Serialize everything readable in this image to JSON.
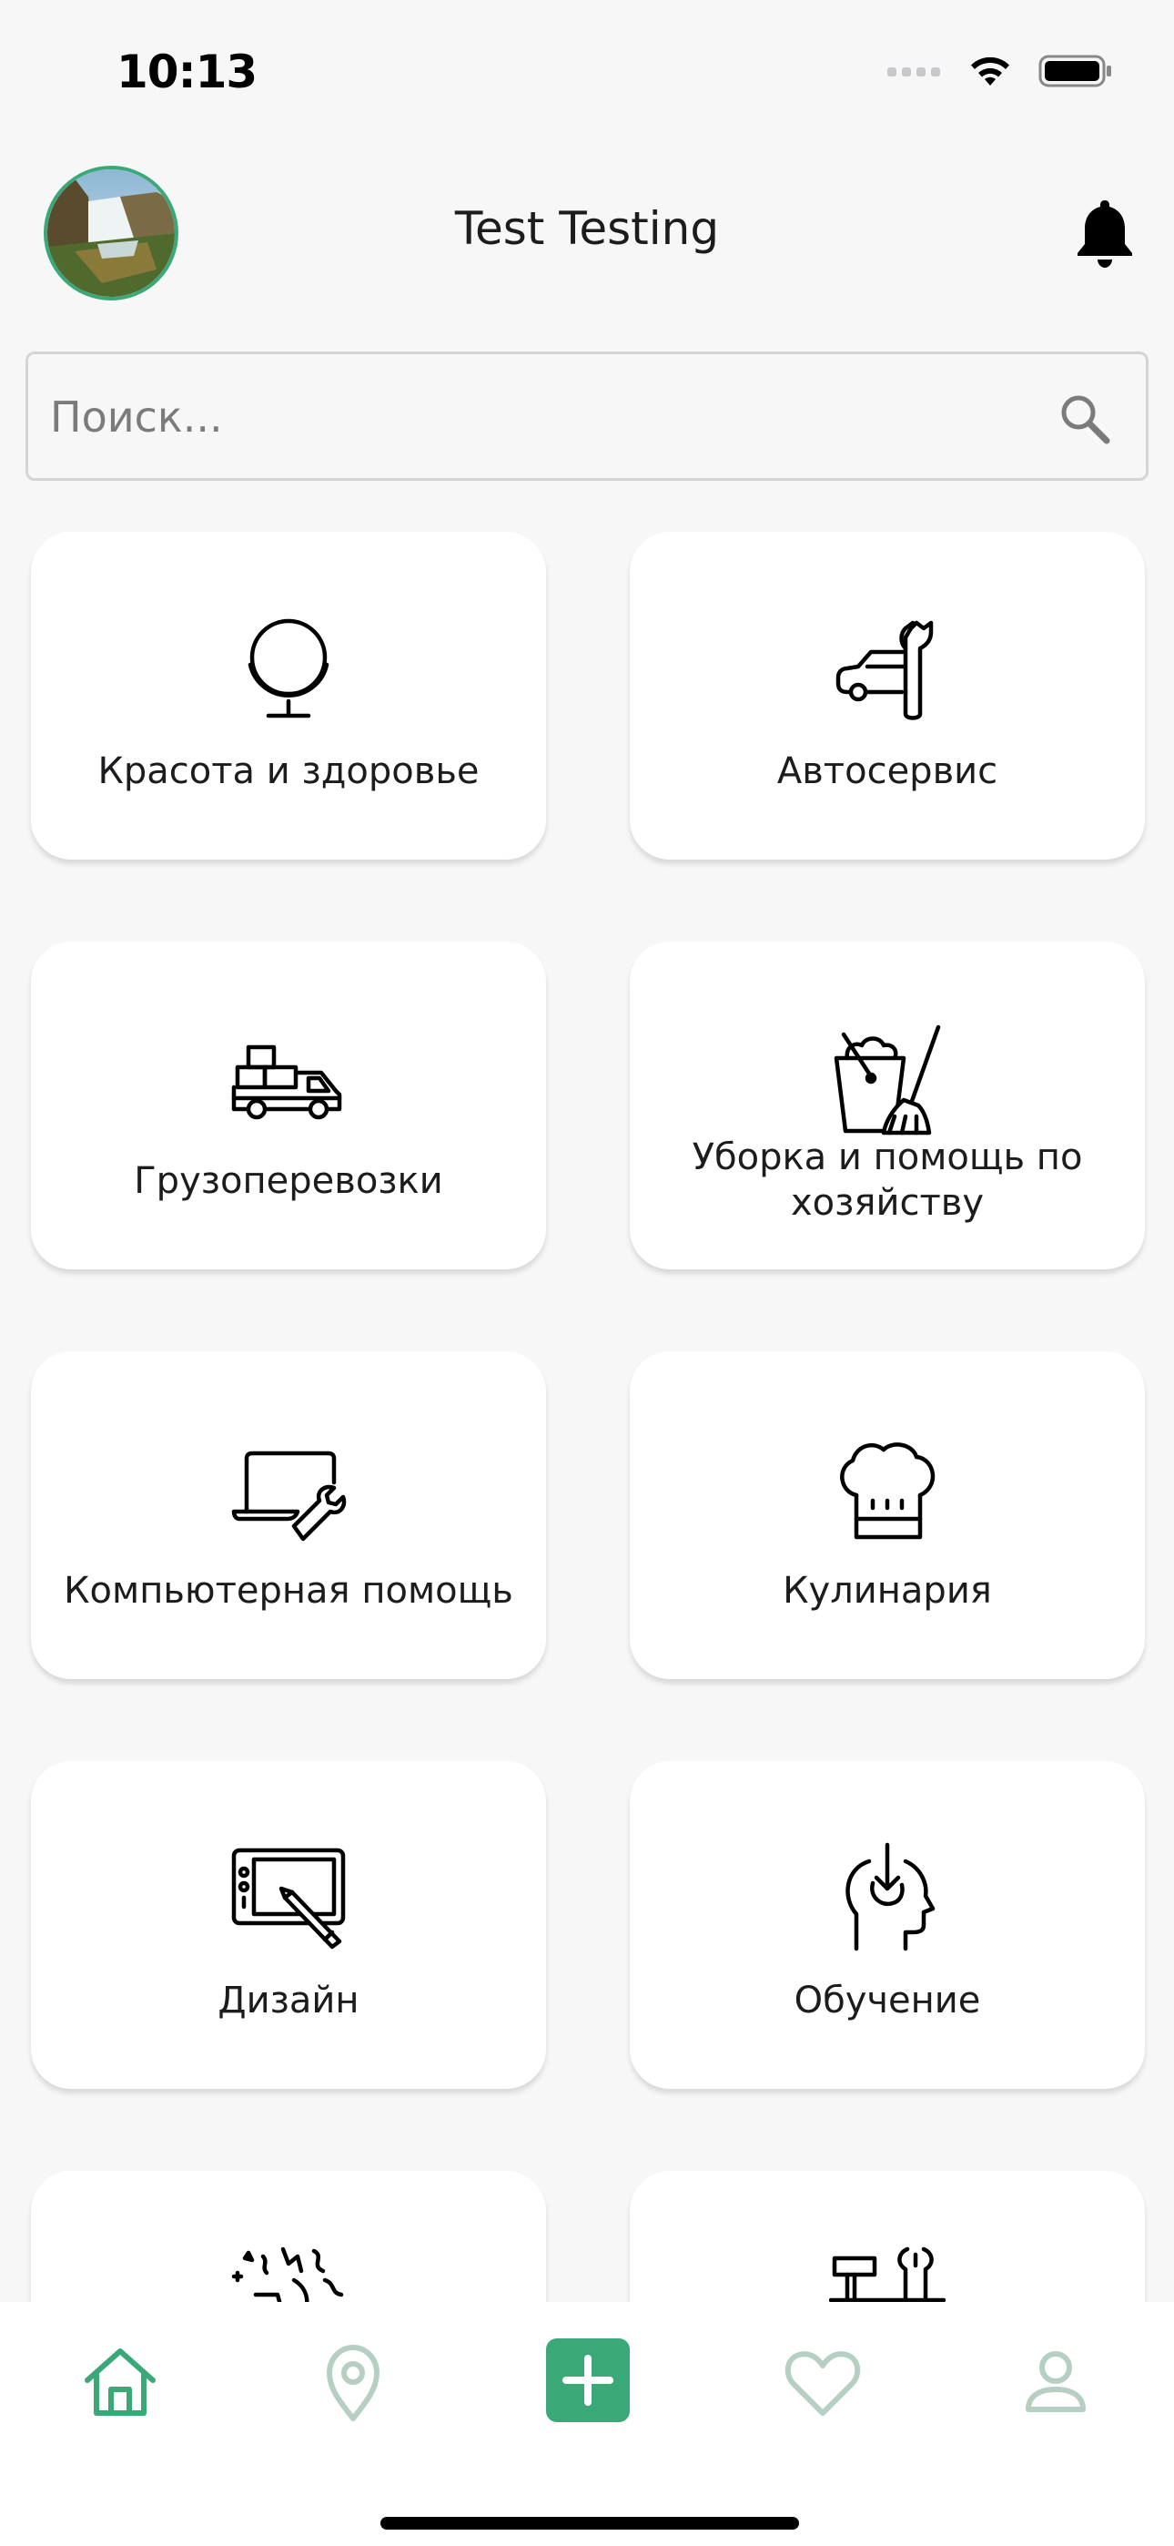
{
  "status_bar": {
    "time": "10:13"
  },
  "header": {
    "title": "Test Testing"
  },
  "search": {
    "placeholder": "Поиск..."
  },
  "categories": [
    {
      "label": "Красота и здоровье",
      "icon": "mirror-icon"
    },
    {
      "label": "Автосервис",
      "icon": "car-wrench-icon"
    },
    {
      "label": "Грузоперевозки",
      "icon": "truck-boxes-icon"
    },
    {
      "label": "Уборка и помощь по хозяйству",
      "icon": "bucket-broom-icon"
    },
    {
      "label": "Компьютерная помощь",
      "icon": "laptop-wrench-icon"
    },
    {
      "label": "Кулинария",
      "icon": "chef-hat-icon"
    },
    {
      "label": "Дизайн",
      "icon": "drawing-tablet-icon"
    },
    {
      "label": "Обучение",
      "icon": "head-learning-icon"
    },
    {
      "label": "",
      "icon": "party-icon"
    },
    {
      "label": "",
      "icon": "tools-icon"
    }
  ],
  "bottom_nav": {
    "items": [
      "home-icon",
      "location-pin-icon",
      "add-icon",
      "heart-icon",
      "profile-icon"
    ],
    "active": "home-icon",
    "accent_color": "#3aa877",
    "inactive_color": "#b5cfc3"
  }
}
